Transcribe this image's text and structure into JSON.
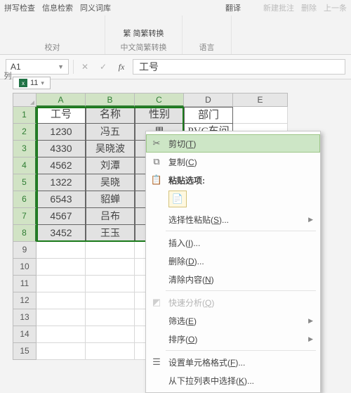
{
  "top_menu": {
    "i0": "拼写检查",
    "i1": "信息检索",
    "i2": "同义词库",
    "i3": "简繁转换",
    "i4": "中文简繁转换",
    "i5": "翻译",
    "i6": "新建批注",
    "i7": "删除",
    "i8": "上一条"
  },
  "ribbon": {
    "g0": "校对",
    "g1": "中文简繁转换",
    "g2": "语言",
    "big": "简繁转换"
  },
  "namebox": {
    "ref": "A1"
  },
  "formula": {
    "value": "工号"
  },
  "sidebar": {
    "label": "列"
  },
  "tab": {
    "name": "11"
  },
  "columns": [
    "A",
    "B",
    "C",
    "D",
    "E"
  ],
  "rows": [
    "1",
    "2",
    "3",
    "4",
    "5",
    "6",
    "7",
    "8",
    "9",
    "10",
    "11",
    "12",
    "13",
    "14",
    "15"
  ],
  "headers": {
    "c1": "工号",
    "c2": "名称",
    "c3": "性别",
    "c4": "部门"
  },
  "first_row_D": "PVC车间",
  "chart_data": {
    "type": "table",
    "columns": [
      "工号",
      "名称",
      "性别",
      "部门"
    ],
    "rows": [
      [
        "1230",
        "冯五",
        "男",
        "PVC车间"
      ],
      [
        "4330",
        "吴晓波",
        "",
        ""
      ],
      [
        "4562",
        "刘潭",
        "",
        ""
      ],
      [
        "1322",
        "吴晓",
        "",
        ""
      ],
      [
        "6543",
        "貂蝉",
        "",
        ""
      ],
      [
        "4567",
        "吕布",
        "",
        ""
      ],
      [
        "3452",
        "王玉",
        "",
        ""
      ]
    ]
  },
  "ctx": {
    "cut": "剪切(T)",
    "copy": "复制(C)",
    "paste_label": "粘贴选项:",
    "paste_special": "选择性粘贴(S)...",
    "insert": "插入(I)...",
    "delete": "删除(D)...",
    "clear": "清除内容(N)",
    "quick": "快速分析(Q)",
    "filter": "筛选(E)",
    "sort": "排序(O)",
    "format": "设置单元格格式(F)...",
    "dropdown": "从下拉列表中选择(K)..."
  }
}
